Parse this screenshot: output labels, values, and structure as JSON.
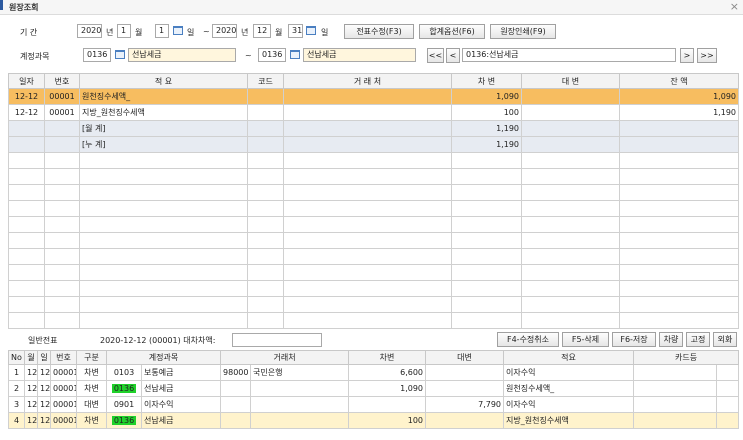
{
  "window": {
    "title": "원장조회",
    "close": "×"
  },
  "filter": {
    "period_label": "기      간",
    "from_year": "2020",
    "year_unit": "년",
    "from_month": "1",
    "month_unit": "월",
    "from_day": "1",
    "day_unit": "일",
    "range_sep": "~",
    "to_year": "2020",
    "to_month": "12",
    "to_day": "31",
    "account_label": "계정과목",
    "acct_from_code": "0136",
    "acct_from_name": "선납세금",
    "acct_sep": "~",
    "acct_to_code": "0136",
    "acct_to_name": "선납세금",
    "nav_first": "<<",
    "nav_prev": "<",
    "nav_current": "0136:선납세금",
    "nav_next": ">",
    "nav_last": ">>"
  },
  "toolbar": {
    "edit_voucher": "전표수정(F3)",
    "sum_option": "합계옵션(F6)",
    "print_ledger": "원장인쇄(F9)"
  },
  "ledger": {
    "columns": [
      "일자",
      "번호",
      "적 요",
      "코드",
      "거 래 처",
      "차    변",
      "대    변",
      "잔    액"
    ],
    "rows": [
      {
        "date": "12-12",
        "no": "00001",
        "memo": "원천징수세액_",
        "code": "",
        "partner": "",
        "debit": "1,090",
        "credit": "",
        "balance": "1,090",
        "selected": true
      },
      {
        "date": "12-12",
        "no": "00001",
        "memo": "지방_원천징수세액",
        "code": "",
        "partner": "",
        "debit": "100",
        "credit": "",
        "balance": "1,190"
      },
      {
        "date": "",
        "no": "",
        "memo": "[월        계]",
        "code": "",
        "partner": "",
        "debit": "1,190",
        "credit": "",
        "balance": "",
        "subtotal": true
      },
      {
        "date": "",
        "no": "",
        "memo": "[누        계]",
        "code": "",
        "partner": "",
        "debit": "1,190",
        "credit": "",
        "balance": "",
        "subtotal": true
      }
    ]
  },
  "voucher_bar": {
    "type_label": "일반전표",
    "info": "2020-12-12 (00001) 대차차액:",
    "diff_value": "",
    "cancel_edit": "F4-수정취소",
    "delete": "F5-삭제",
    "save": "F6-저장",
    "debit_btn": "차량",
    "fixed_btn": "고정",
    "foreign_btn": "외화"
  },
  "voucher": {
    "columns": [
      "No",
      "월",
      "일",
      "번호",
      "구분",
      "계정과목",
      "",
      "거래처",
      "",
      "차변",
      "대변",
      "적요",
      "카드등",
      ""
    ],
    "rows": [
      {
        "no": "1",
        "month": "12",
        "day": "12",
        "num": "00001",
        "type": "차변",
        "acct_code": "0103",
        "acct_name": "보통예금",
        "partner_code": "98000",
        "partner_name": "국민은행",
        "debit": "6,600",
        "credit": "",
        "memo": "이자수익",
        "card": ""
      },
      {
        "no": "2",
        "month": "12",
        "day": "12",
        "num": "00001",
        "type": "차변",
        "acct_code": "0136",
        "acct_name": "선납세금",
        "partner_code": "",
        "partner_name": "",
        "debit": "1,090",
        "credit": "",
        "memo": "원천징수세액_",
        "card": "",
        "highlight_code": true
      },
      {
        "no": "3",
        "month": "12",
        "day": "12",
        "num": "00001",
        "type": "대변",
        "acct_code": "0901",
        "acct_name": "이자수익",
        "partner_code": "",
        "partner_name": "",
        "debit": "",
        "credit": "7,790",
        "memo": "이자수익",
        "card": ""
      },
      {
        "no": "4",
        "month": "12",
        "day": "12",
        "num": "00001",
        "type": "차변",
        "acct_code": "0136",
        "acct_name": "선납세금",
        "partner_code": "",
        "partner_name": "",
        "debit": "100",
        "credit": "",
        "memo": "지방_원천징수세액",
        "card": "",
        "highlight_code": true,
        "current": true
      }
    ]
  },
  "colors": {
    "selected_row": "#f7bd60",
    "subtotal_row": "#e7ebf2",
    "code_highlight": "#1fd12a",
    "current_row": "#fff3cc"
  }
}
